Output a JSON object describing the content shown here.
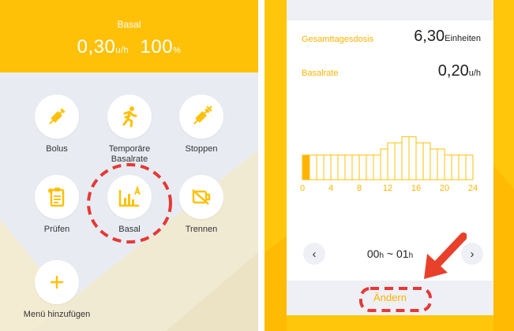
{
  "left_panel": {
    "header": {
      "title": "Basal",
      "rate_value": "0,30",
      "rate_unit": "u/h",
      "percent_value": "100",
      "percent_unit": "%"
    },
    "tiles": [
      {
        "label": "Bolus",
        "icon": "syringe-icon"
      },
      {
        "label": "Temporäre Basalrate",
        "icon": "running-icon"
      },
      {
        "label": "Stoppen",
        "icon": "syringe-stop-icon"
      },
      {
        "label": "Prüfen",
        "icon": "clipboard-check-icon"
      },
      {
        "label": "Basal",
        "icon": "basal-chart-icon"
      },
      {
        "label": "Trennen",
        "icon": "disconnect-icon"
      },
      {
        "label": "Menü hinzufügen",
        "icon": "plus-icon"
      }
    ]
  },
  "right_panel": {
    "total_daily_dose": {
      "label": "Gesamttagesdosis",
      "value": "6,30",
      "unit": "Einheiten"
    },
    "basal_rate": {
      "label": "Basalrate",
      "value": "0,20",
      "unit": "u/h"
    },
    "chart_data": {
      "type": "bar",
      "hours": [
        0,
        1,
        2,
        3,
        4,
        5,
        6,
        7,
        8,
        9,
        10,
        11,
        12,
        13,
        14,
        15,
        16,
        17,
        18,
        19,
        20,
        21,
        22,
        23
      ],
      "values": [
        0.2,
        0.2,
        0.2,
        0.2,
        0.2,
        0.2,
        0.2,
        0.2,
        0.2,
        0.2,
        0.2,
        0.25,
        0.3,
        0.3,
        0.35,
        0.35,
        0.3,
        0.3,
        0.25,
        0.25,
        0.2,
        0.2,
        0.2,
        0.2
      ],
      "selected_hour": 0,
      "tick_labels": [
        "0",
        "4",
        "8",
        "12",
        "16",
        "20",
        "24"
      ],
      "ylim": [
        0,
        0.5
      ]
    },
    "time_range": {
      "start": "00",
      "start_unit": "h",
      "sep": "~",
      "end": "01",
      "end_unit": "h"
    },
    "change_label": "Ändern"
  },
  "colors": {
    "accent": "#ffc107",
    "accent_text": "#ffb300",
    "highlight_dash": "#e53935",
    "arrow": "#e8402a"
  }
}
